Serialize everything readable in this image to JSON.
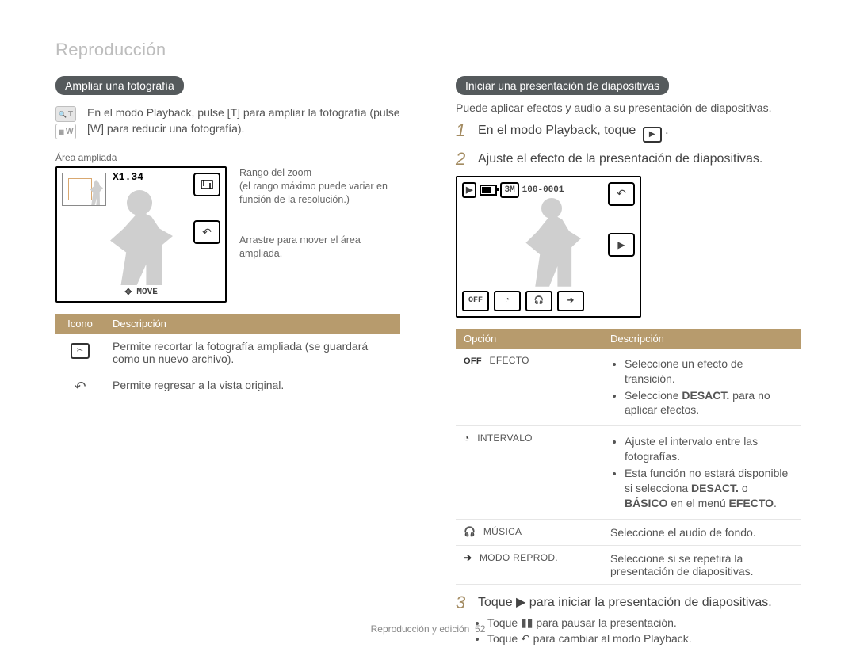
{
  "page_title": "Reproducción",
  "footer": {
    "section": "Reproducción y edición",
    "page": "52"
  },
  "left": {
    "heading": "Ampliar una fotografía",
    "keys": {
      "zoom_in": "T",
      "zoom_out": "W"
    },
    "intro": "En el modo Playback, pulse [T] para ampliar la fotografía (pulse [W] para reducir una fotografía).",
    "area_label": "Área ampliada",
    "lcd": {
      "zoom_value": "X1.34",
      "move_label": "MOVE"
    },
    "callouts": {
      "zoom_range": "Rango del zoom\n(el rango máximo puede variar en función de la resolución.)",
      "drag": "Arrastre para mover el área ampliada."
    },
    "table": {
      "headers": {
        "icon": "Icono",
        "desc": "Descripción"
      },
      "rows": [
        {
          "icon": "crop-icon",
          "desc": "Permite recortar la fotografía ampliada (se guardará como un nuevo archivo)."
        },
        {
          "icon": "back-icon",
          "desc": "Permite regresar a la vista original."
        }
      ]
    }
  },
  "right": {
    "heading": "Iniciar una presentación de diapositivas",
    "intro": "Puede aplicar efectos y audio a su presentación de diapositivas.",
    "steps": {
      "s1": "En el modo Playback, toque",
      "s2": "Ajuste el efecto de la presentación de diapositivas.",
      "s3": "Toque ▶ para iniciar la presentación de diapositivas."
    },
    "lcd": {
      "counter": "100-0001",
      "size_badge": "3M",
      "off": "OFF"
    },
    "table": {
      "headers": {
        "opt": "Opción",
        "desc": "Descripción"
      },
      "rows": {
        "efecto": {
          "label": "EFECTO",
          "prefix": "OFF",
          "bullets": [
            "Seleccione un efecto de transición.",
            "Seleccione DESACT. para no aplicar efectos."
          ]
        },
        "intervalo": {
          "label": "INTERVALO",
          "bullets": [
            "Ajuste el intervalo entre las fotografías.",
            "Esta función no estará disponible si selecciona DESACT. o BÁSICO en el menú EFECTO."
          ]
        },
        "musica": {
          "label": "MÚSICA",
          "desc": "Seleccione el audio de fondo."
        },
        "modo": {
          "label": "MODO REPROD.",
          "desc": "Seleccione si se repetirá la presentación de diapositivas."
        }
      }
    },
    "sub": {
      "pause": "Toque ▮▮ para pausar la presentación.",
      "back": "Toque ↶ para cambiar al modo Playback."
    }
  }
}
